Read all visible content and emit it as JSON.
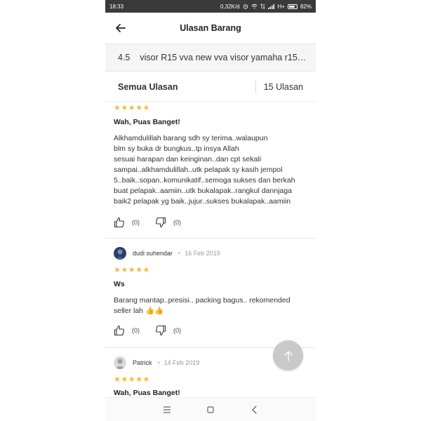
{
  "status_bar": {
    "time": "18:33",
    "speed": "0,32K/d",
    "network": "H+",
    "battery": "82%",
    "battery_level": 0.82
  },
  "header": {
    "title": "Ulasan Barang"
  },
  "product": {
    "rating": "4.5",
    "name": "visor R15 vva new vva visor yamaha r15v..."
  },
  "filter": {
    "label": "Semua Ulasan",
    "count": "15 Ulasan"
  },
  "reviews": [
    {
      "stars": "★★★★★",
      "title": "Wah, Puas Banget!",
      "body": "Alkhamdulillah barang sdh sy terima..walaupun\nblm sy buka dr bungkus..tp insya Allah\nsesuai harapan dan keinginan..dan cpt sekali\nsampai..alkhamdulillah..utk pelapak sy kasih jempol\n5..baik..sopan..komunikatif..semoga sukses dan berkah\nbuat pelapak..aamiin..utk bukalapak..rangkul dannjaga\nbaik2 pelapak yg baik..jujur..sukses bukalapak..aamiin",
      "likes": "(0)",
      "dislikes": "(0)"
    },
    {
      "author": "dudi suhendar",
      "separator": "•",
      "date": "16 Feb 2019",
      "stars": "★★★★★",
      "title": "Ws",
      "body": "Barang mantap..presisi.. packing bagus.. rekomended\nseller lah 👍👍",
      "likes": "(0)",
      "dislikes": "(0)"
    },
    {
      "author": "Patrick",
      "separator": "•",
      "date": "14 Feb 2019",
      "stars": "★★★★★",
      "title": "Wah, Puas Banget!"
    }
  ],
  "colors": {
    "star": "#f6b93b",
    "fab": "#c9c9c9",
    "status_bar": "#3a3a3a"
  }
}
